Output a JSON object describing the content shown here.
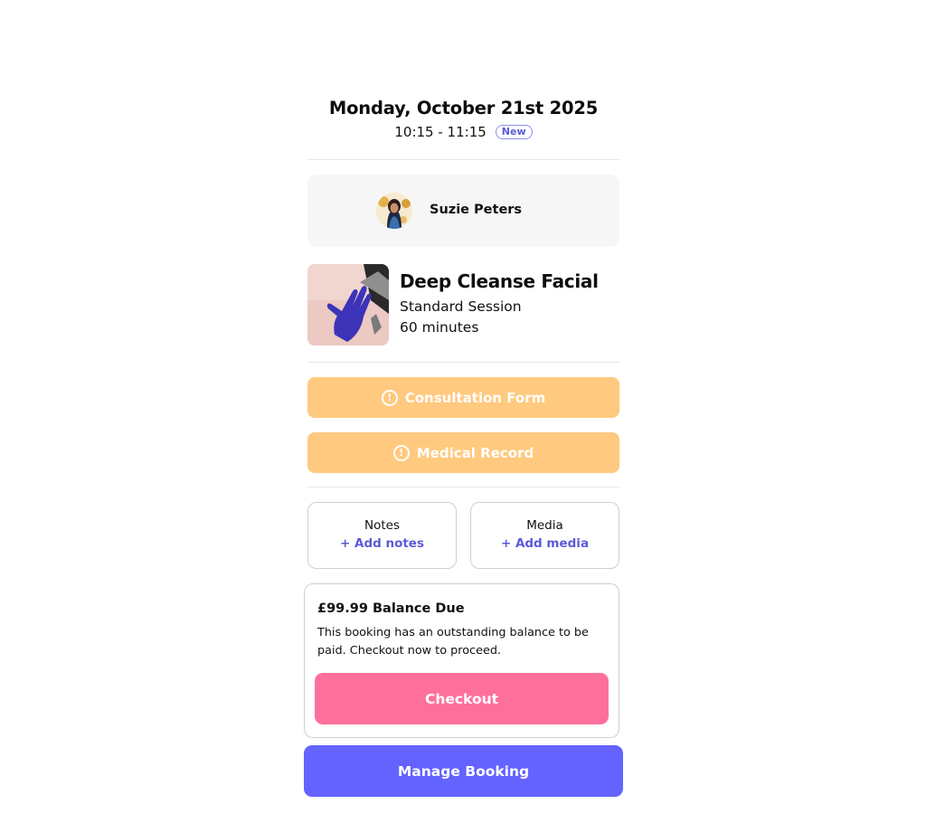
{
  "booking": {
    "date": "Monday, October 21st 2025",
    "time": "10:15 - 11:15",
    "status_badge": "New"
  },
  "client": {
    "name": "Suzie Peters"
  },
  "service": {
    "title": "Deep Cleanse Facial",
    "type": "Standard Session",
    "duration": "60 minutes"
  },
  "forms": {
    "consultation_label": "Consultation Form",
    "medical_label": "Medical Record",
    "warning_glyph": "!"
  },
  "notes": {
    "title": "Notes",
    "action": "+ Add notes"
  },
  "media": {
    "title": "Media",
    "action": "+ Add media"
  },
  "balance": {
    "title": "£99.99 Balance Due",
    "message": "This booking has an outstanding balance to be paid. Checkout now to proceed.",
    "checkout_label": "Checkout"
  },
  "actions": {
    "manage_label": "Manage Booking"
  },
  "colors": {
    "accent": "#6463ff",
    "checkout": "#ff6f9c",
    "form_warning": "#ffc97f",
    "link": "#5b5bd6"
  }
}
